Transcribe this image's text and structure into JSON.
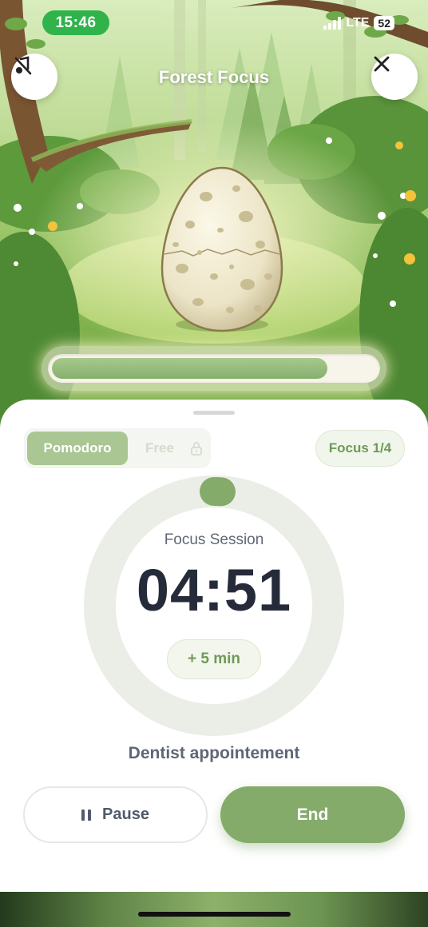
{
  "status_bar": {
    "time": "15:46",
    "network": "LTE",
    "battery": "52"
  },
  "header": {
    "title": "Forest Focus"
  },
  "buttons": {
    "music_icon": "music-off-icon",
    "close_icon": "close-icon"
  },
  "egg": {
    "state": "unhatched",
    "progress_fraction": 0.85
  },
  "mode": {
    "active_label": "Pomodoro",
    "inactive_label": "Free",
    "lock_icon": "lock-icon"
  },
  "focus_badge": "Focus 1/4",
  "timer": {
    "label": "Focus Session",
    "time": "04:51",
    "ring_progress_fraction": 0.02
  },
  "add_time_label": "+ 5 min",
  "task_name": "Dentist appointement",
  "actions": {
    "pause_label": "Pause",
    "end_label": "End"
  },
  "colors": {
    "accent": "#84ab6a",
    "status_green": "#2fb34a",
    "timer_text": "#252b39"
  }
}
